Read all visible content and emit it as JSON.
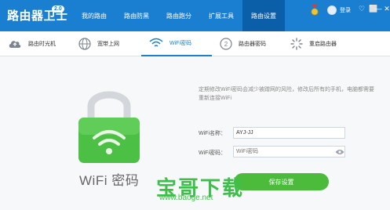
{
  "app": {
    "title": "路由器卫士",
    "version": "2.0",
    "login": "登录"
  },
  "nav": [
    {
      "label": "我的路由",
      "active": false
    },
    {
      "label": "路由防黑",
      "active": false
    },
    {
      "label": "路由跑分",
      "active": false
    },
    {
      "label": "扩展工具",
      "active": false
    },
    {
      "label": "路由设置",
      "active": true
    }
  ],
  "window_controls": [
    "♡",
    "⬜",
    "—",
    "✕"
  ],
  "subtabs": [
    {
      "label": "路由时光机",
      "icon": "cloud-upload-icon",
      "active": false
    },
    {
      "label": "宽带上网",
      "icon": "globe-icon",
      "active": false
    },
    {
      "label": "WiFi密码",
      "icon": "wifi-icon",
      "active": true
    },
    {
      "label": "路由器密码",
      "icon": "router-password-icon",
      "active": false
    },
    {
      "label": "重启路由器",
      "icon": "restart-icon",
      "active": false
    }
  ],
  "main": {
    "caption": "WiFi 密码",
    "info_text": "定期修改WiFi密码会减少被蹭网的风险，修改后所有的手机，电脑都需要重新连接WiFi",
    "name_label": "WiFi名称：",
    "name_value": "AYJ-JJ",
    "password_label": "WiFi密码：",
    "password_placeholder": "WiFi密码",
    "save_label": "保存设置"
  },
  "watermark": {
    "text": "宝哥下载",
    "url": "www.baoge.net"
  },
  "colors": {
    "brand": "#1a7fd0",
    "accent": "#4cbb3c"
  }
}
